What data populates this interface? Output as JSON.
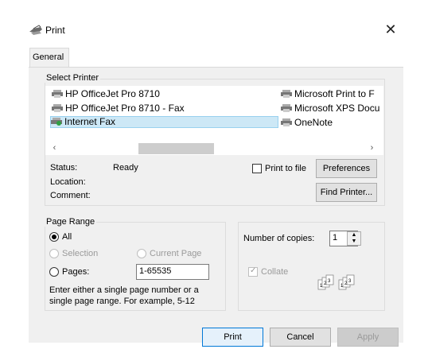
{
  "window": {
    "title": "Print"
  },
  "tabs": [
    {
      "label": "General"
    }
  ],
  "select_printer": {
    "label": "Select Printer",
    "printers": [
      {
        "name": "HP OfficeJet Pro 8710"
      },
      {
        "name": "HP OfficeJet Pro 8710 - Fax"
      },
      {
        "name": "Internet Fax",
        "selected": true
      },
      {
        "name": "Microsoft Print to F"
      },
      {
        "name": "Microsoft XPS Docu"
      },
      {
        "name": "OneNote"
      }
    ],
    "status_label": "Status:",
    "status_value": "Ready",
    "location_label": "Location:",
    "comment_label": "Comment:",
    "print_to_file_label": "Print to file",
    "print_to_file_checked": false,
    "preferences_label": "Preferences",
    "find_printer_label": "Find Printer..."
  },
  "page_range": {
    "label": "Page Range",
    "all_label": "All",
    "selection_label": "Selection",
    "current_page_label": "Current Page",
    "pages_label": "Pages:",
    "pages_value": "1-65535",
    "selected": "All",
    "hint_line1": "Enter either a single page number or a",
    "hint_line2": "single page range.  For example, 5-12"
  },
  "copies": {
    "label": "Number of copies:",
    "value": "1",
    "collate_label": "Collate",
    "collate_checked": true
  },
  "footer": {
    "print_label": "Print",
    "cancel_label": "Cancel",
    "apply_label": "Apply"
  },
  "icons": {
    "title_icon": "printer-icon",
    "close_icon": "close-icon",
    "printer_item_icon": "printer-icon",
    "collate_icon": "collate-pages-icon"
  },
  "colors": {
    "selection_bg": "#cde8f6",
    "selection_border": "#99d1ef",
    "primary_button_border": "#0078d7",
    "dialog_bg": "#f0f0f0"
  }
}
